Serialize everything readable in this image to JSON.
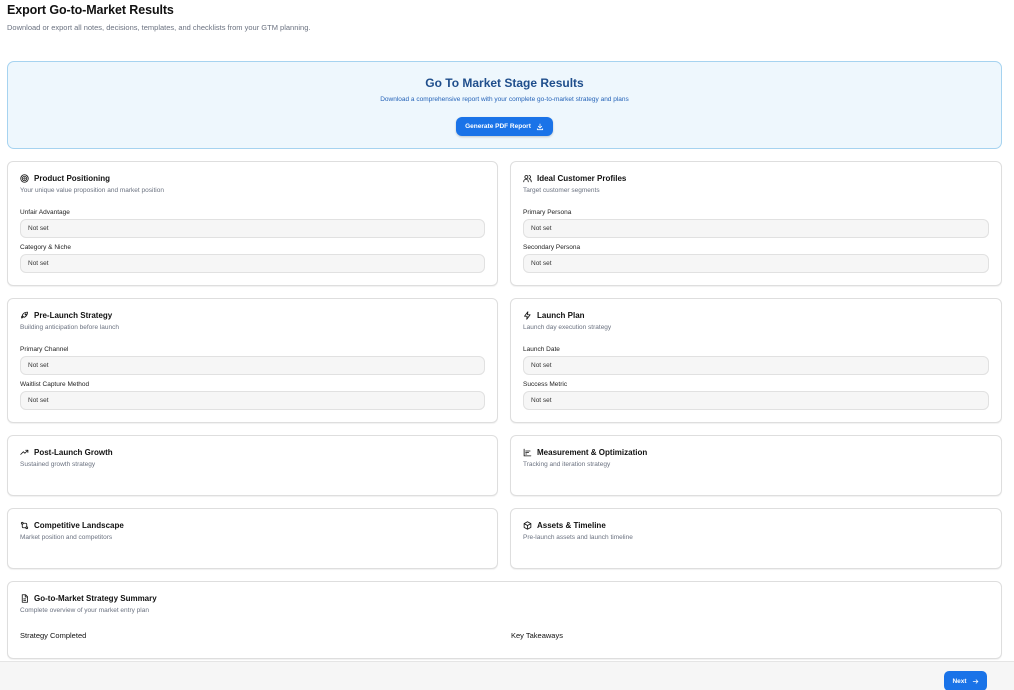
{
  "header": {
    "title": "Export Go-to-Market Results",
    "subtitle": "Download or export all notes, decisions, templates, and checklists from your GTM planning."
  },
  "hero": {
    "title": "Go To Market Stage Results",
    "subtitle": "Download a comprehensive report with your complete go-to-market strategy and plans",
    "button_label": "Generate PDF Report"
  },
  "cards": {
    "product_positioning": {
      "title": "Product Positioning",
      "description": "Your unique value proposition and market position",
      "fields": [
        {
          "label": "Unfair Advantage",
          "value": "Not set"
        },
        {
          "label": "Category & Niche",
          "value": "Not set"
        }
      ]
    },
    "ideal_customer_profiles": {
      "title": "Ideal Customer Profiles",
      "description": "Target customer segments",
      "fields": [
        {
          "label": "Primary Persona",
          "value": "Not set"
        },
        {
          "label": "Secondary Persona",
          "value": "Not set"
        }
      ]
    },
    "pre_launch_strategy": {
      "title": "Pre-Launch Strategy",
      "description": "Building anticipation before launch",
      "fields": [
        {
          "label": "Primary Channel",
          "value": "Not set"
        },
        {
          "label": "Waitlist Capture Method",
          "value": "Not set"
        }
      ]
    },
    "launch_plan": {
      "title": "Launch Plan",
      "description": "Launch day execution strategy",
      "fields": [
        {
          "label": "Launch Date",
          "value": "Not set"
        },
        {
          "label": "Success Metric",
          "value": "Not set"
        }
      ]
    },
    "post_launch_growth": {
      "title": "Post-Launch Growth",
      "description": "Sustained growth strategy"
    },
    "measurement_optimization": {
      "title": "Measurement & Optimization",
      "description": "Tracking and iteration strategy"
    },
    "competitive_landscape": {
      "title": "Competitive Landscape",
      "description": "Market position and competitors"
    },
    "assets_timeline": {
      "title": "Assets & Timeline",
      "description": "Pre-launch assets and launch timeline"
    },
    "strategy_summary": {
      "title": "Go-to-Market Strategy Summary",
      "description": "Complete overview of your market entry plan",
      "left_label": "Strategy Completed",
      "right_label": "Key Takeaways"
    }
  },
  "footer": {
    "next_label": "Next"
  },
  "icons": {
    "product_positioning": "target-icon",
    "ideal_customer_profiles": "users-icon",
    "pre_launch_strategy": "rocket-icon",
    "launch_plan": "zap-icon",
    "post_launch_growth": "trending-up-icon",
    "measurement_optimization": "bar-chart-icon",
    "competitive_landscape": "git-compare-icon",
    "assets_timeline": "box-icon",
    "strategy_summary": "document-icon",
    "hero_button": "download-icon",
    "next_button": "arrow-right-icon"
  },
  "colors": {
    "accent": "#1a73e8",
    "hero_background": "#eef7fd",
    "hero_border": "#a6d3f0",
    "hero_title": "#1f4e8c"
  }
}
